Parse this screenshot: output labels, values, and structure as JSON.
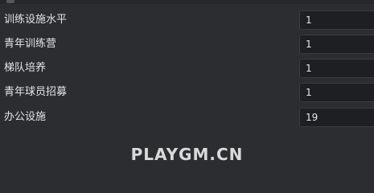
{
  "settings": {
    "rows": [
      {
        "label": "训练设施水平",
        "value": "1"
      },
      {
        "label": "青年训练营",
        "value": "1"
      },
      {
        "label": "梯队培养",
        "value": "1"
      },
      {
        "label": "青年球员招募",
        "value": "1"
      },
      {
        "label": "办公设施",
        "value": "19"
      }
    ]
  },
  "watermark": {
    "text": "PLAYGM.CN"
  },
  "colors": {
    "background": "#2b2d31",
    "input_background": "#1d1f22",
    "label_text": "#e3e4e6"
  }
}
